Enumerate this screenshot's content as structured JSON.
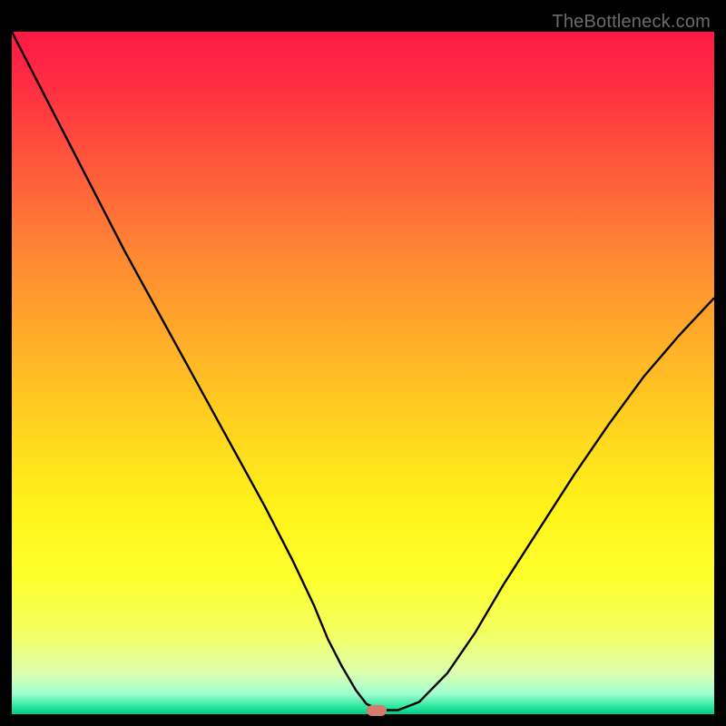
{
  "attribution": "TheBottleneck.com",
  "colors": {
    "gradient_top": "#ff1846",
    "gradient_mid": "#fff31a",
    "gradient_bottom": "#06c884",
    "curve": "#000000",
    "marker": "#d57b6e",
    "background": "#000000"
  },
  "chart_data": {
    "type": "line",
    "title": "",
    "xlabel": "",
    "ylabel": "",
    "xlim": [
      0,
      100
    ],
    "ylim": [
      0,
      100
    ],
    "x": [
      0,
      2,
      5,
      8,
      12,
      16,
      20,
      24,
      28,
      32,
      36,
      40,
      43,
      45,
      47,
      49,
      50.5,
      52.5,
      55,
      58,
      62,
      66,
      70,
      75,
      80,
      85,
      90,
      95,
      100
    ],
    "y": [
      100,
      96,
      90,
      84,
      76,
      68,
      60.5,
      53,
      45.5,
      38,
      30.5,
      22.5,
      16,
      11,
      7,
      3.5,
      1.5,
      0.6,
      0.6,
      1.8,
      6,
      12,
      19,
      27,
      35,
      42.5,
      49.5,
      55.5,
      61
    ],
    "marker": {
      "x": 52,
      "y": 0.5
    },
    "background_gradient": "vertical red→yellow→green",
    "note": "V-shaped bottleneck curve; minimum around x≈52"
  }
}
